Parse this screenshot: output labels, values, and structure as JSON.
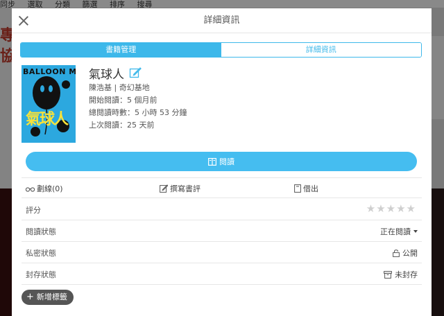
{
  "background": {
    "toolbar_items": [
      "同步",
      "選取",
      "分類",
      "篩選",
      "排序",
      "搜尋"
    ],
    "left_label": "專協"
  },
  "modal": {
    "title": "詳細資訊",
    "tabs": [
      {
        "label": "書籍管理",
        "active": true
      },
      {
        "label": "詳細資訊",
        "active": false
      }
    ],
    "book": {
      "cover_title": "BALLOON MAN",
      "cover_cn": "氣球人",
      "title": "氣球人",
      "author_publisher": "陳浩基 | 奇幻基地",
      "started": "開始閱讀：5 個月前",
      "total_time": "總閱讀時數：5 小時 53 分鐘",
      "last_read": "上次閱讀：25 天前"
    },
    "read_button": "閱讀",
    "actions": {
      "highlights": "劃線(0)",
      "review": "撰寫書評",
      "lend": "借出"
    },
    "rating": {
      "label": "評分",
      "stars": "★★★★★",
      "value": 0,
      "max": 5
    },
    "reading_status": {
      "label": "閱讀狀態",
      "value": "正在閱讀"
    },
    "privacy": {
      "label": "私密狀態",
      "value": "公開"
    },
    "archive": {
      "label": "封存狀態",
      "value": "未封存"
    },
    "add_tag": "新增標籤"
  },
  "colors": {
    "accent": "#3db8ea",
    "read_button": "#45bdf0",
    "tag_button": "#555555",
    "cover_blue": "#2ca8df",
    "cover_yellow": "#f7e23a"
  }
}
